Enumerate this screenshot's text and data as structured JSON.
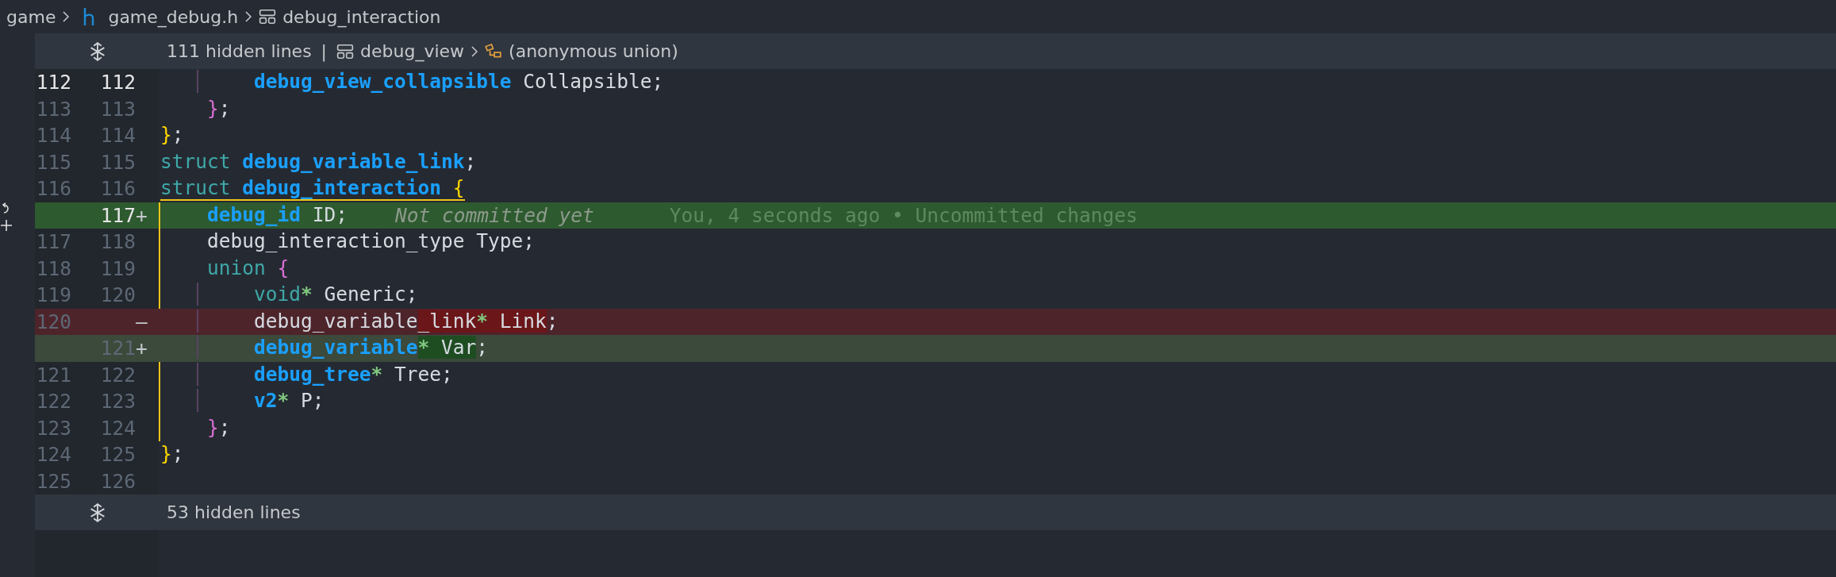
{
  "breadcrumbs": [
    {
      "label": "game",
      "kind": "folder"
    },
    {
      "label": "game_debug.h",
      "kind": "header"
    },
    {
      "label": "debug_interaction",
      "kind": "struct"
    }
  ],
  "hidden_top": {
    "text": "111 hidden lines",
    "separator": "|",
    "path": [
      {
        "label": "debug_view",
        "kind": "struct"
      },
      {
        "label": "(anonymous union)",
        "kind": "union"
      }
    ]
  },
  "lines": [
    {
      "old": "112",
      "new": "112",
      "added": false,
      "removed": false,
      "modified": false,
      "current": true,
      "bracket_open": false,
      "bracket_inside": false,
      "tokens": [
        {
          "text": "        debug_view_collapsible",
          "kind": "type"
        },
        {
          "text": " Collapsible;",
          "kind": "plain"
        }
      ]
    },
    {
      "old": "113",
      "new": "113",
      "added": false,
      "removed": false,
      "modified": false,
      "current": false,
      "bracket_open": false,
      "bracket_inside": false,
      "tokens": [
        {
          "text": "    }",
          "kind": "brace2"
        },
        {
          "text": ";",
          "kind": "plain"
        }
      ]
    },
    {
      "old": "114",
      "new": "114",
      "added": false,
      "removed": false,
      "modified": false,
      "current": false,
      "bracket_open": false,
      "bracket_inside": false,
      "tokens": [
        {
          "text": "}",
          "kind": "brace1"
        },
        {
          "text": ";",
          "kind": "plain"
        }
      ]
    },
    {
      "old": "115",
      "new": "115",
      "added": false,
      "removed": false,
      "modified": false,
      "current": false,
      "bracket_open": false,
      "bracket_inside": false,
      "tokens": [
        {
          "text": "struct",
          "kind": "keyword"
        },
        {
          "text": " debug_variable_link",
          "kind": "type"
        },
        {
          "text": ";",
          "kind": "plain"
        }
      ]
    },
    {
      "old": "116",
      "new": "116",
      "added": false,
      "removed": false,
      "modified": false,
      "current": false,
      "bracket_open": true,
      "bracket_inside": false,
      "tokens": [
        {
          "text": "struct",
          "kind": "keyword"
        },
        {
          "text": " debug_interaction",
          "kind": "type"
        },
        {
          "text": " {",
          "kind": "brace1"
        }
      ]
    },
    {
      "new": "117",
      "marker": "+",
      "added": true,
      "removed": false,
      "modified": false,
      "current": true,
      "bracket_open": false,
      "bracket_inside": true,
      "tokens": [
        {
          "text": "    debug_id",
          "kind": "type"
        },
        {
          "text": " ID;",
          "kind": "plain"
        }
      ],
      "annotation": "Not committed yet",
      "blame": "You, 4 seconds ago • Uncommitted changes"
    },
    {
      "old": "117",
      "new": "118",
      "added": false,
      "removed": false,
      "modified": false,
      "current": false,
      "bracket_open": false,
      "bracket_inside": true,
      "tokens": [
        {
          "text": "    debug_interaction_type Type;",
          "kind": "plain"
        }
      ]
    },
    {
      "old": "118",
      "new": "119",
      "added": false,
      "removed": false,
      "modified": false,
      "current": false,
      "bracket_open": false,
      "bracket_inside": true,
      "tokens": [
        {
          "text": "    union",
          "kind": "keyword"
        },
        {
          "text": " {",
          "kind": "brace2"
        }
      ]
    },
    {
      "old": "119",
      "new": "120",
      "added": false,
      "removed": false,
      "modified": false,
      "current": false,
      "bracket_open": false,
      "bracket_inside": true,
      "tokens": [
        {
          "text": "        void",
          "kind": "keyword"
        },
        {
          "text": "*",
          "kind": "star"
        },
        {
          "text": " Generic;",
          "kind": "plain"
        }
      ]
    },
    {
      "old": "120",
      "marker": "—",
      "added": false,
      "removed": true,
      "modified": false,
      "current": false,
      "bracket_open": false,
      "bracket_inside": false,
      "tokens": [
        {
          "text": "        debug_variable",
          "kind": "plain"
        },
        {
          "text": "_link",
          "kind": "plain",
          "hl": true
        },
        {
          "text": "*",
          "kind": "star",
          "hl": true
        },
        {
          "text": " Link",
          "kind": "plain",
          "hl": true
        },
        {
          "text": ";",
          "kind": "plain"
        }
      ]
    },
    {
      "new": "121",
      "marker": "+",
      "added": false,
      "removed": false,
      "modified": true,
      "current": false,
      "bracket_open": false,
      "bracket_inside": false,
      "tokens": [
        {
          "text": "        debug_variable",
          "kind": "type"
        },
        {
          "text": "*",
          "kind": "star",
          "hl": true
        },
        {
          "text": " Var",
          "kind": "plain",
          "hl": true
        },
        {
          "text": ";",
          "kind": "plain"
        }
      ]
    },
    {
      "old": "121",
      "new": "122",
      "added": false,
      "removed": false,
      "modified": false,
      "current": false,
      "bracket_open": false,
      "bracket_inside": true,
      "tokens": [
        {
          "text": "        debug_tree",
          "kind": "type"
        },
        {
          "text": "*",
          "kind": "star"
        },
        {
          "text": " Tree;",
          "kind": "plain"
        }
      ]
    },
    {
      "old": "122",
      "new": "123",
      "added": false,
      "removed": false,
      "modified": false,
      "current": false,
      "bracket_open": false,
      "bracket_inside": true,
      "tokens": [
        {
          "text": "        v2",
          "kind": "type"
        },
        {
          "text": "*",
          "kind": "star"
        },
        {
          "text": " P;",
          "kind": "plain"
        }
      ]
    },
    {
      "old": "123",
      "new": "124",
      "added": false,
      "removed": false,
      "modified": false,
      "current": false,
      "bracket_open": false,
      "bracket_inside": true,
      "tokens": [
        {
          "text": "    }",
          "kind": "brace2"
        },
        {
          "text": ";",
          "kind": "plain"
        }
      ]
    },
    {
      "old": "124",
      "new": "125",
      "added": false,
      "removed": false,
      "modified": false,
      "current": false,
      "bracket_open": false,
      "bracket_inside": false,
      "tokens": [
        {
          "text": "}",
          "kind": "brace1"
        },
        {
          "text": ";",
          "kind": "plain"
        }
      ]
    },
    {
      "old": "125",
      "new": "126",
      "added": false,
      "removed": false,
      "modified": false,
      "current": false,
      "bracket_open": false,
      "bracket_inside": false
    }
  ],
  "hidden_bottom": {
    "text": "53 hidden lines"
  }
}
